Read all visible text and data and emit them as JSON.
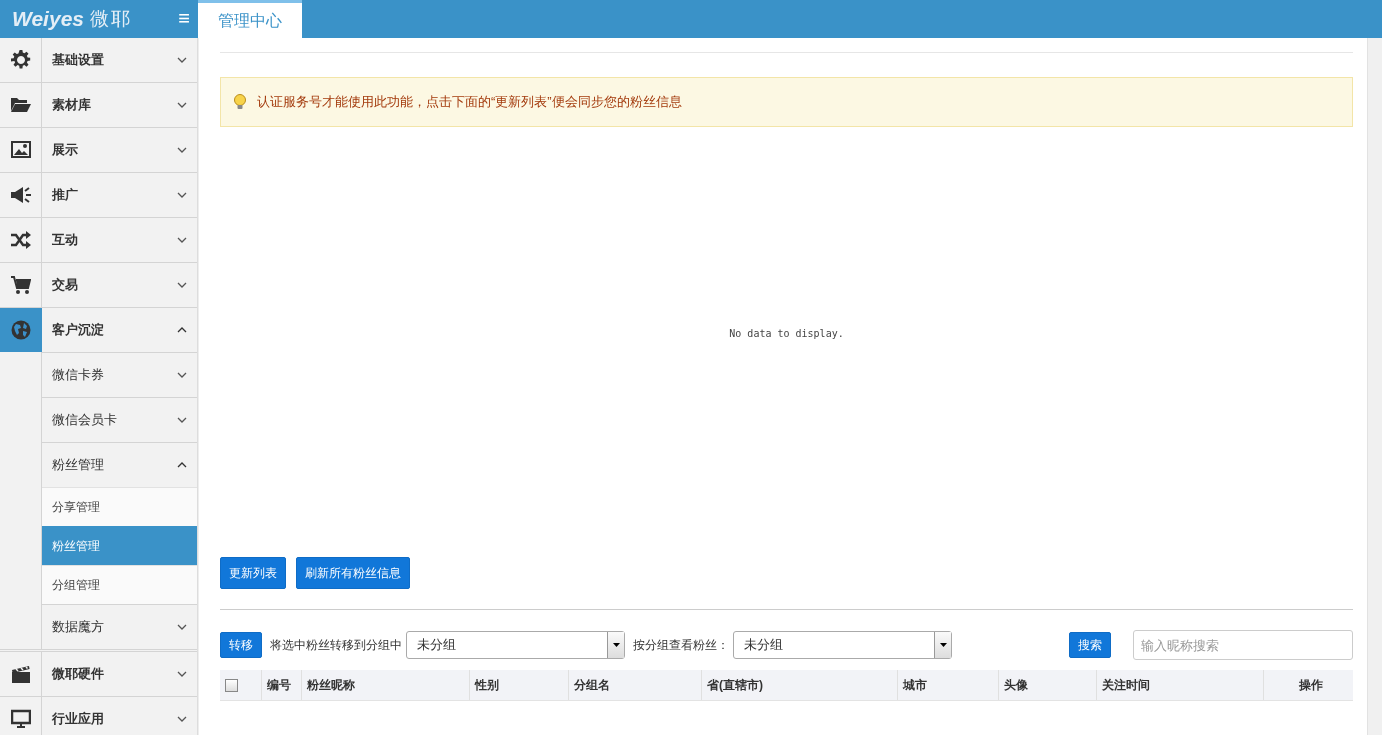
{
  "header": {
    "logo_latin": "Weiyes",
    "logo_cn": "微耶",
    "menu_toggle": "≡"
  },
  "tabs": [
    {
      "label": "管理中心",
      "selected": true
    }
  ],
  "sidebar": {
    "items": [
      {
        "label": "基础设置",
        "expanded": false,
        "selected": false
      },
      {
        "label": "素材库",
        "expanded": false,
        "selected": false
      },
      {
        "label": "展示",
        "expanded": false,
        "selected": false
      },
      {
        "label": "推广",
        "expanded": false,
        "selected": false
      },
      {
        "label": "互动",
        "expanded": false,
        "selected": false
      },
      {
        "label": "交易",
        "expanded": false,
        "selected": false
      },
      {
        "label": "客户沉淀",
        "expanded": true,
        "selected": true,
        "children": [
          {
            "label": "微信卡券",
            "expanded": false
          },
          {
            "label": "微信会员卡",
            "expanded": false
          },
          {
            "label": "粉丝管理",
            "expanded": true,
            "children": [
              {
                "label": "分享管理",
                "selected": false
              },
              {
                "label": "粉丝管理",
                "selected": true
              },
              {
                "label": "分组管理",
                "selected": false
              }
            ]
          },
          {
            "label": "数据魔方",
            "expanded": false
          }
        ]
      },
      {
        "label": "微耶硬件",
        "expanded": false,
        "selected": false
      },
      {
        "label": "行业应用",
        "expanded": false,
        "selected": false
      }
    ]
  },
  "alert": {
    "text": "认证服务号才能使用此功能，点击下面的“更新列表”便会同步您的粉丝信息"
  },
  "empty_message": "No data to display.",
  "actions": [
    "更新列表",
    "刷新所有粉丝信息"
  ],
  "toolbar": {
    "move_button": "转移",
    "move_label": "将选中粉丝转移到分组中",
    "move_select": "未分组",
    "view_label": "按分组查看粉丝：",
    "view_select": "未分组",
    "search_button": "搜索",
    "search": {
      "placeholder": "输入昵称搜索"
    }
  },
  "table": {
    "select_all": {
      "checked": false
    },
    "columns": [
      "编号",
      "粉丝昵称",
      "性别",
      "分组名",
      "省(直辖市)",
      "城市",
      "头像",
      "关注时间",
      "操作"
    ]
  }
}
